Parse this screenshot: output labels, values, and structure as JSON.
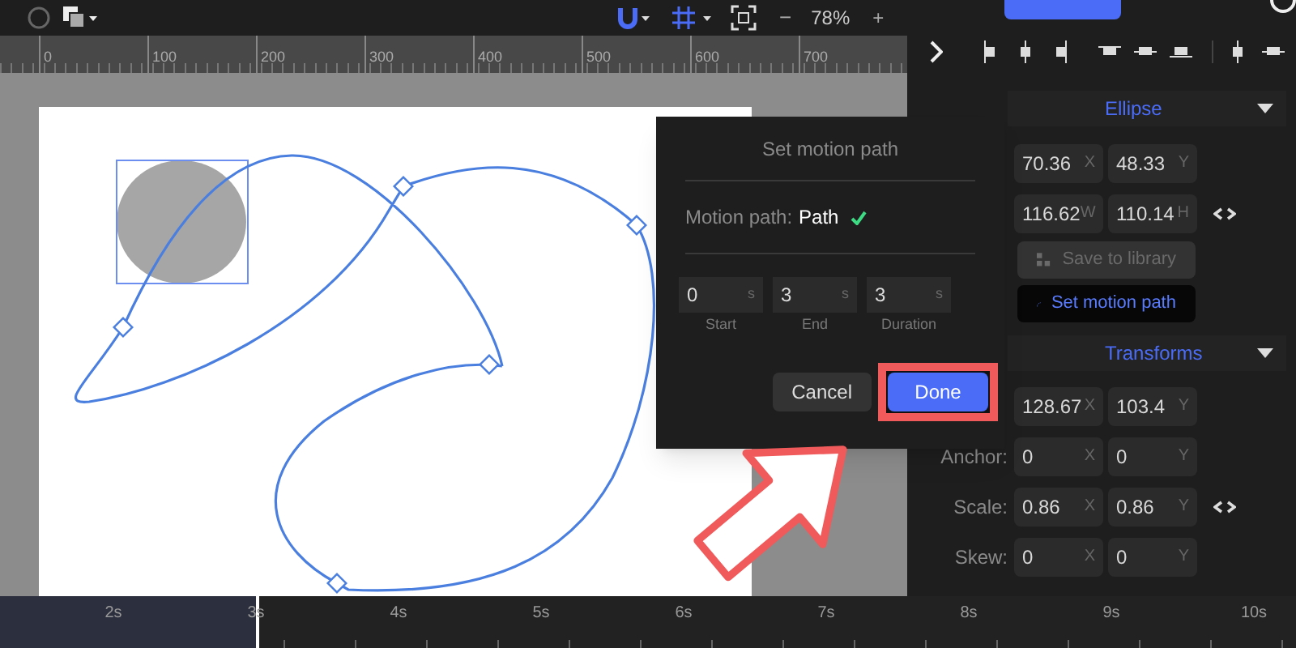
{
  "toolbar": {
    "zoom_out": "−",
    "zoom": "78%",
    "zoom_in": "+"
  },
  "ruler": {
    "labels": [
      "0",
      "100",
      "200",
      "300",
      "400",
      "500",
      "600",
      "700"
    ]
  },
  "dialog": {
    "title": "Set motion path",
    "motion_path_label": "Motion path:",
    "motion_path_value": "Path",
    "path_set": true,
    "fields": [
      {
        "value": "0",
        "unit": "s",
        "label": "Start"
      },
      {
        "value": "3",
        "unit": "s",
        "label": "End"
      },
      {
        "value": "3",
        "unit": "s",
        "label": "Duration"
      }
    ],
    "buttons": [
      {
        "label": "Cancel",
        "kind": "secondary",
        "highlighted": false
      },
      {
        "label": "Done",
        "kind": "primary",
        "highlighted": true
      }
    ]
  },
  "ellipse_section": {
    "title": "Ellipse",
    "expanded": true,
    "rows": [
      {
        "fields": [
          {
            "value": "70.36",
            "axis": "X"
          },
          {
            "value": "48.33",
            "axis": "Y"
          }
        ],
        "linked": false
      },
      {
        "fields": [
          {
            "value": "116.62",
            "axis": "W"
          },
          {
            "value": "110.14",
            "axis": "H"
          }
        ],
        "linked": true
      }
    ],
    "buttons": [
      {
        "label": "Save to library",
        "kind": "library",
        "disabled": true
      },
      {
        "label": "Set motion path",
        "kind": "motion",
        "disabled": false
      }
    ]
  },
  "transforms_section": {
    "title": "Transforms",
    "expanded": true,
    "rows": [
      {
        "fields": [
          {
            "value": "128.67",
            "axis": "X"
          },
          {
            "value": "103.4",
            "axis": "Y"
          }
        ],
        "linked": false
      },
      {
        "label": "Anchor:",
        "fields": [
          {
            "value": "0",
            "axis": "X"
          },
          {
            "value": "0",
            "axis": "Y"
          }
        ],
        "linked": false
      },
      {
        "label": "Scale:",
        "fields": [
          {
            "value": "0.86",
            "axis": "X"
          },
          {
            "value": "0.86",
            "axis": "Y"
          }
        ],
        "linked": true
      },
      {
        "label": "Skew:",
        "fields": [
          {
            "value": "0",
            "axis": "X"
          },
          {
            "value": "0",
            "axis": "Y"
          }
        ],
        "linked": false
      }
    ]
  },
  "timeline": {
    "labels": [
      "2s",
      "3s",
      "4s",
      "5s",
      "6s",
      "7s",
      "8s",
      "9s",
      "10s"
    ],
    "level": 0.2
  }
}
